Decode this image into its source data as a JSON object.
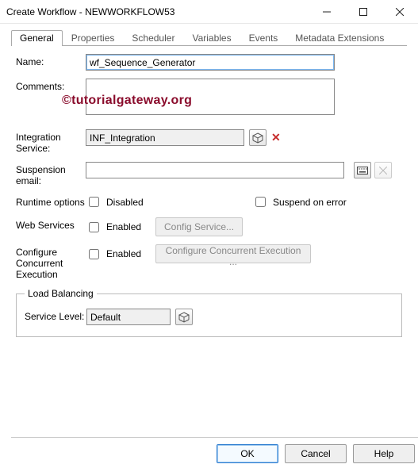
{
  "window": {
    "title": "Create Workflow - NEWWORKFLOW53"
  },
  "tabs": {
    "general": "General",
    "properties": "Properties",
    "scheduler": "Scheduler",
    "variables": "Variables",
    "events": "Events",
    "metadata": "Metadata Extensions"
  },
  "labels": {
    "name": "Name:",
    "comments": "Comments:",
    "integration": "Integration Service:",
    "suspension": "Suspension email:",
    "runtime": "Runtime options",
    "web": "Web Services",
    "configure": "Configure Concurrent Execution",
    "service": "Service Level:"
  },
  "fields": {
    "name": "wf_Sequence_Generator",
    "comments": "",
    "integration": "INF_Integration",
    "suspension": "",
    "service": "Default"
  },
  "checks": {
    "disabled": "Disabled",
    "suspend": "Suspend on error",
    "enabled_ws": "Enabled",
    "enabled_cc": "Enabled"
  },
  "buttons": {
    "config_service": "Config Service...",
    "config_concurrent": "Configure Concurrent Execution ...",
    "ok": "OK",
    "cancel": "Cancel",
    "help": "Help"
  },
  "fieldset": {
    "load_balancing": "Load Balancing"
  },
  "icons": {
    "remove": "✕"
  },
  "watermark": "©tutorialgateway.org"
}
